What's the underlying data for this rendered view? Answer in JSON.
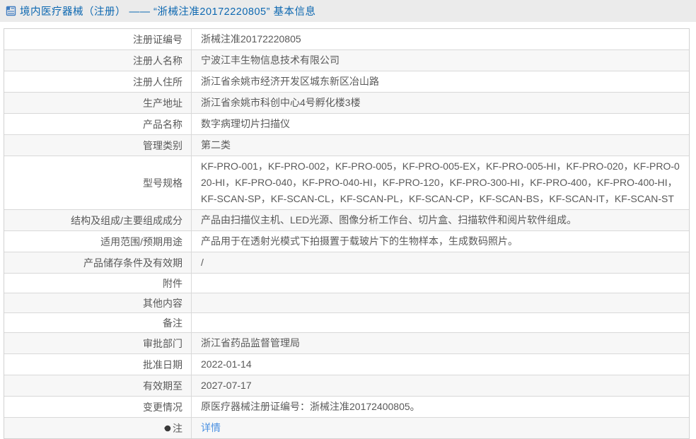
{
  "page": {
    "title": "境内医疗器械（注册） —— “浙械注准20172220805” 基本信息"
  },
  "colors": {
    "title_blue": "#0d68b1",
    "link_blue": "#4a90e2",
    "alt_row_bg": "#f7f7f7",
    "border": "#d9d9d9",
    "header_bar_bg": "#ebebeb",
    "cell_text": "#595959"
  },
  "icons": {
    "header_icon": "document-icon",
    "note_icon": "note-icon"
  },
  "table": {
    "rows": [
      {
        "label": "注册证编号",
        "value": "浙械注准20172220805"
      },
      {
        "label": "注册人名称",
        "value": "宁波江丰生物信息技术有限公司"
      },
      {
        "label": "注册人住所",
        "value": "浙江省余姚市经济开发区城东新区冶山路"
      },
      {
        "label": "生产地址",
        "value": "浙江省余姚市科创中心4号孵化楼3楼"
      },
      {
        "label": "产品名称",
        "value": "数字病理切片扫描仪"
      },
      {
        "label": "管理类别",
        "value": "第二类"
      },
      {
        "label": "型号规格",
        "value": "KF-PRO-001，KF-PRO-002，KF-PRO-005，KF-PRO-005-EX，KF-PRO-005-HI，KF-PRO-020，KF-PRO-020-HI，KF-PRO-040，KF-PRO-040-HI，KF-PRO-120，KF-PRO-300-HI，KF-PRO-400，KF-PRO-400-HI，KF-SCAN-SP，KF-SCAN-CL，KF-SCAN-PL，KF-SCAN-CP，KF-SCAN-BS，KF-SCAN-IT，KF-SCAN-ST"
      },
      {
        "label": "结构及组成/主要组成成分",
        "value": "产品由扫描仪主机、LED光源、图像分析工作台、切片盒、扫描软件和阅片软件组成。"
      },
      {
        "label": "适用范围/预期用途",
        "value": "产品用于在透射光模式下拍摄置于载玻片下的生物样本，生成数码照片。"
      },
      {
        "label": "产品储存条件及有效期",
        "value": "/"
      },
      {
        "label": "附件",
        "value": ""
      },
      {
        "label": "其他内容",
        "value": ""
      },
      {
        "label": "备注",
        "value": ""
      },
      {
        "label": "审批部门",
        "value": "浙江省药品监督管理局"
      },
      {
        "label": "批准日期",
        "value": "2022-01-14"
      },
      {
        "label": "有效期至",
        "value": "2027-07-17"
      },
      {
        "label": "变更情况",
        "value": "原医疗器械注册证编号：浙械注准20172400805。"
      },
      {
        "label": "注",
        "value": "详情"
      }
    ]
  }
}
